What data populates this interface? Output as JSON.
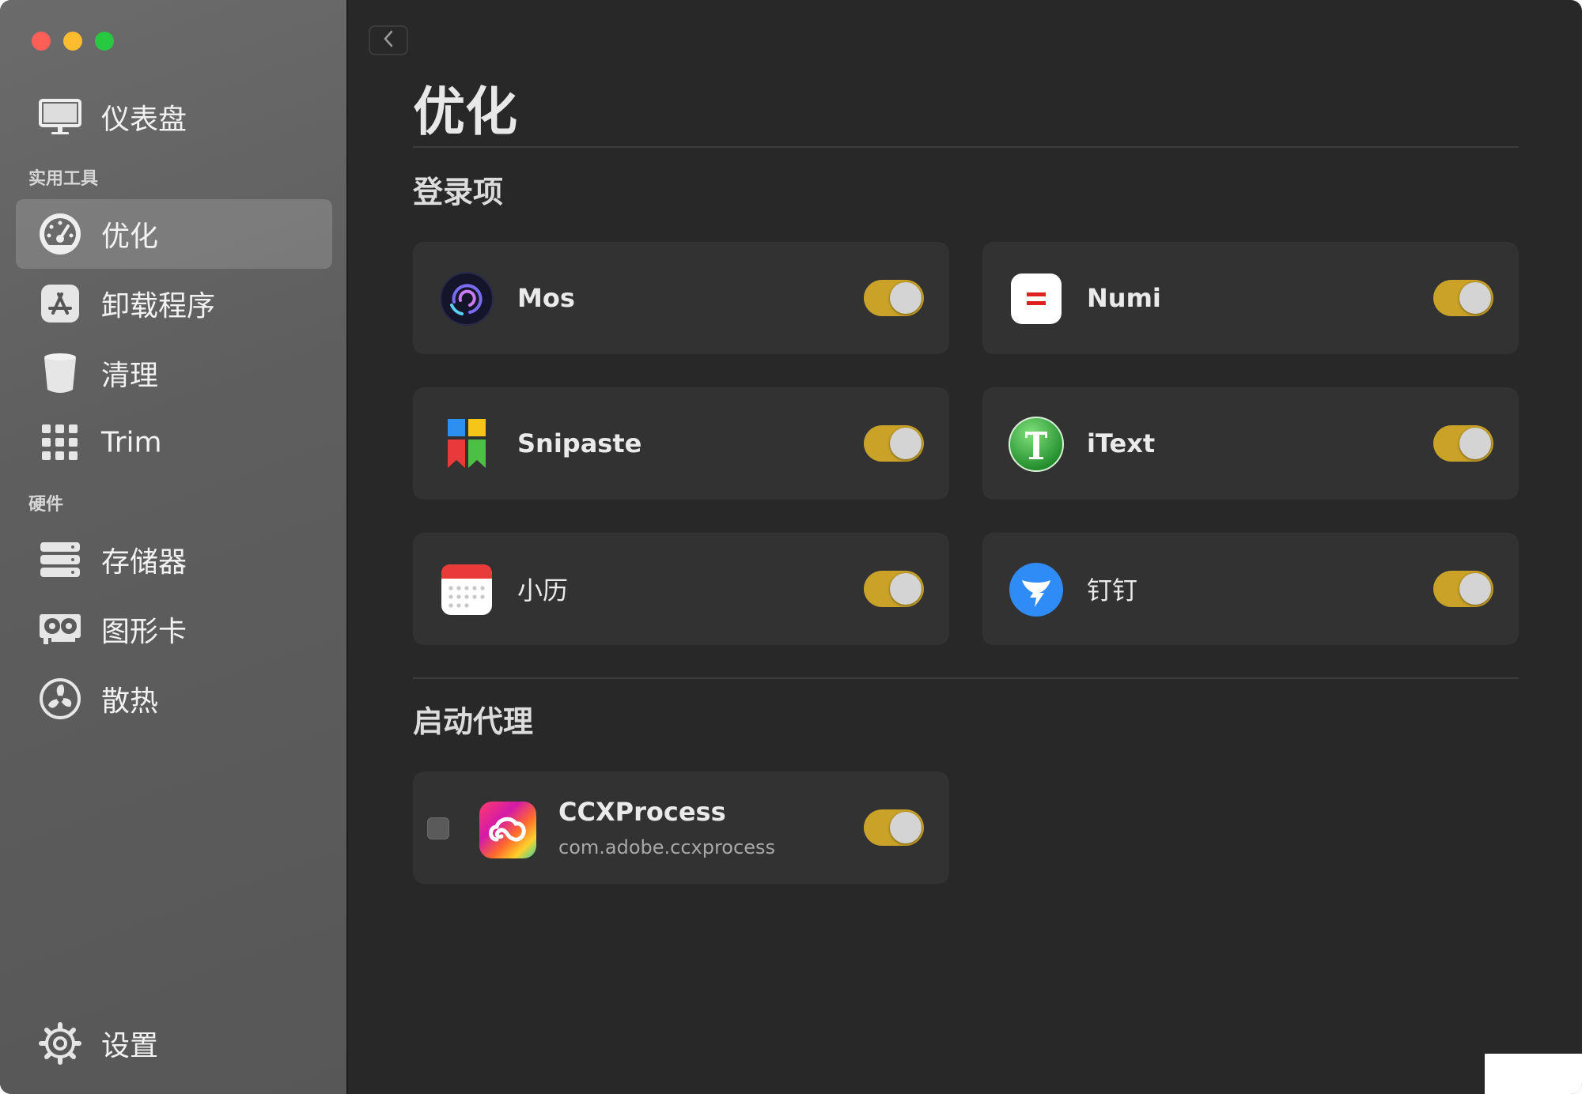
{
  "window": {
    "traffic_lights": {
      "close": "#ff5f57",
      "minimize": "#febc2e",
      "maximize": "#28c840"
    }
  },
  "sidebar": {
    "dashboard": {
      "label": "仪表盘",
      "icon": "monitor-icon"
    },
    "section_utilities": "实用工具",
    "utilities": [
      {
        "label": "优化",
        "icon": "speedometer-icon",
        "active": true
      },
      {
        "label": "卸载程序",
        "icon": "app-store-icon",
        "active": false
      },
      {
        "label": "清理",
        "icon": "trash-bin-icon",
        "active": false
      },
      {
        "label": "Trim",
        "icon": "grid-icon",
        "active": false
      }
    ],
    "section_hardware": "硬件",
    "hardware": [
      {
        "label": "存储器",
        "icon": "server-icon"
      },
      {
        "label": "图形卡",
        "icon": "graphics-card-icon"
      },
      {
        "label": "散热",
        "icon": "fan-icon"
      }
    ],
    "settings": {
      "label": "设置",
      "icon": "gear-icon"
    }
  },
  "main": {
    "page_title": "优化",
    "login_items_title": "登录项",
    "login_items": [
      {
        "name": "Mos",
        "icon": "mos-app-icon",
        "enabled": true
      },
      {
        "name": "Numi",
        "icon": "numi-app-icon",
        "enabled": true
      },
      {
        "name": "Snipaste",
        "icon": "snipaste-app-icon",
        "enabled": true
      },
      {
        "name": "iText",
        "icon": "itext-app-icon",
        "enabled": true
      },
      {
        "name": "小历",
        "icon": "calendar-app-icon",
        "enabled": true
      },
      {
        "name": "钉钉",
        "icon": "dingtalk-app-icon",
        "enabled": true
      }
    ],
    "launch_agents_title": "启动代理",
    "launch_agents": [
      {
        "name": "CCXProcess",
        "bundle_id": "com.adobe.ccxprocess",
        "icon": "creative-cloud-icon",
        "enabled": true,
        "checked": false
      }
    ]
  },
  "colors": {
    "accent_toggle": "#c9a227",
    "background": "#282828",
    "card": "#323232"
  }
}
